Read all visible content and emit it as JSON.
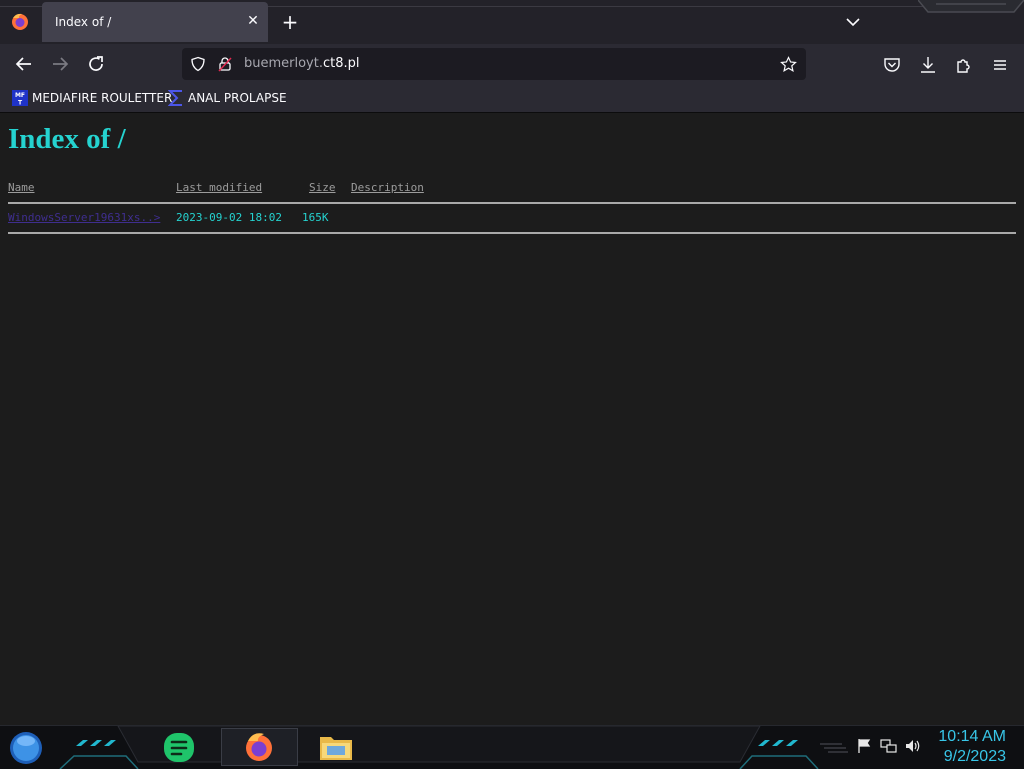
{
  "browser": {
    "tab": {
      "title": "Index of /"
    },
    "url": {
      "host_prefix": "buemerloyt.",
      "host_domain": "ct8.pl"
    },
    "bookmarks": [
      {
        "label": "MEDIAFIRE ROULETTER",
        "icon": "mediafire-icon"
      },
      {
        "label": "ANAL PROLAPSE",
        "icon": "sigma-icon"
      }
    ]
  },
  "page": {
    "title": "Index of /",
    "columns": {
      "name": "Name",
      "last_modified": "Last modified",
      "size": "Size",
      "description": "Description"
    },
    "rows": [
      {
        "name": "WindowsServer19631xs..>",
        "last_modified": "2023-09-02 18:02",
        "size": "165K",
        "description": ""
      }
    ]
  },
  "taskbar": {
    "clock_time": "10:14 AM",
    "clock_date": "9/2/2023",
    "apps": [
      "start-orb-icon",
      "notes-app-icon",
      "firefox-icon",
      "file-explorer-icon"
    ]
  },
  "colors": {
    "accent": "#25d3d0",
    "link": "#3f2e8f",
    "background": "#1c1c1c"
  }
}
